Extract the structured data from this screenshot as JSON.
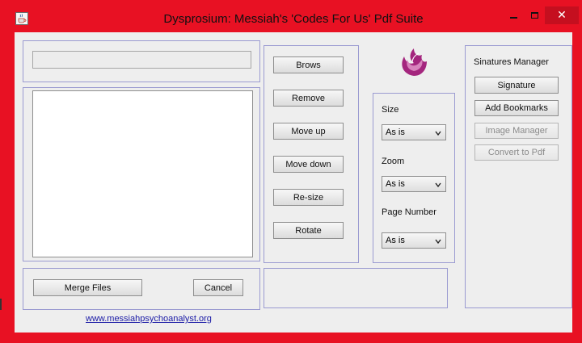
{
  "window": {
    "title": "Dysprosium: Messiah's 'Codes For Us' Pdf Suite",
    "close_glyph": "✕"
  },
  "file_panel": {
    "path_value": "",
    "list_items": []
  },
  "actions": {
    "browse": "Brows",
    "remove": "Remove",
    "move_up": "Move up",
    "move_down": "Move down",
    "resize": "Re-size",
    "rotate": "Rotate"
  },
  "options": {
    "size_label": "Size",
    "size_value": "As is",
    "zoom_label": "Zoom",
    "zoom_value": "As is",
    "page_number_label": "Page Number",
    "page_number_value": "As is"
  },
  "signatures": {
    "heading": "Sinatures Manager",
    "signature": "Signature",
    "add_bookmarks": "Add Bookmarks",
    "image_manager": "Image Manager",
    "convert_to_pdf": "Convert to Pdf"
  },
  "bottom": {
    "merge_files": "Merge Files",
    "cancel": "Cancel"
  },
  "footer": {
    "link": "www.messiahpsychoanalyst.org"
  },
  "colors": {
    "frame": "#e81123",
    "panel_border": "#9b9bd1",
    "logo": "#a4267e"
  },
  "icons": {
    "app": "java-cup-icon",
    "logo": "phoenix-logo-icon"
  }
}
